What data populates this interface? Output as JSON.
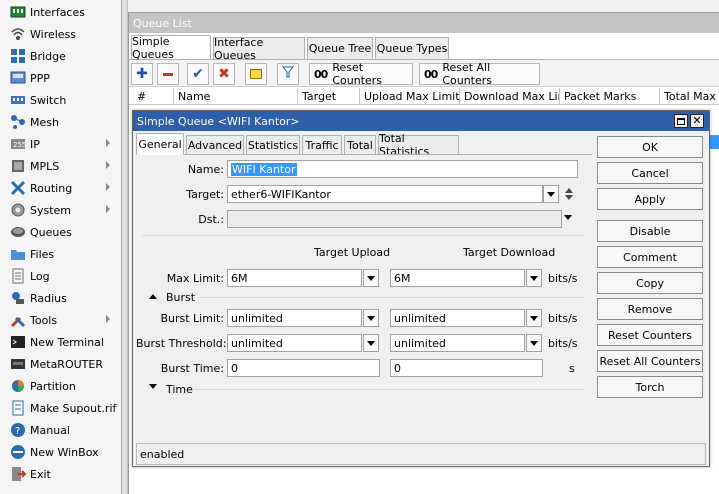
{
  "sidebar": {
    "items": [
      {
        "label": "Interfaces",
        "icon": "interfaces-icon",
        "submenu": false
      },
      {
        "label": "Wireless",
        "icon": "wireless-icon",
        "submenu": false
      },
      {
        "label": "Bridge",
        "icon": "bridge-icon",
        "submenu": false
      },
      {
        "label": "PPP",
        "icon": "ppp-icon",
        "submenu": false
      },
      {
        "label": "Switch",
        "icon": "switch-icon",
        "submenu": false
      },
      {
        "label": "Mesh",
        "icon": "mesh-icon",
        "submenu": false
      },
      {
        "label": "IP",
        "icon": "ip-icon",
        "submenu": true
      },
      {
        "label": "MPLS",
        "icon": "mpls-icon",
        "submenu": true
      },
      {
        "label": "Routing",
        "icon": "routing-icon",
        "submenu": true
      },
      {
        "label": "System",
        "icon": "system-icon",
        "submenu": true
      },
      {
        "label": "Queues",
        "icon": "queues-icon",
        "submenu": false
      },
      {
        "label": "Files",
        "icon": "files-icon",
        "submenu": false
      },
      {
        "label": "Log",
        "icon": "log-icon",
        "submenu": false
      },
      {
        "label": "Radius",
        "icon": "radius-icon",
        "submenu": false
      },
      {
        "label": "Tools",
        "icon": "tools-icon",
        "submenu": true
      },
      {
        "label": "New Terminal",
        "icon": "terminal-icon",
        "submenu": false
      },
      {
        "label": "MetaROUTER",
        "icon": "metarouter-icon",
        "submenu": false
      },
      {
        "label": "Partition",
        "icon": "partition-icon",
        "submenu": false
      },
      {
        "label": "Make Supout.rif",
        "icon": "supout-icon",
        "submenu": false
      },
      {
        "label": "Manual",
        "icon": "manual-icon",
        "submenu": false
      },
      {
        "label": "New WinBox",
        "icon": "winbox-icon",
        "submenu": false
      },
      {
        "label": "Exit",
        "icon": "exit-icon",
        "submenu": false
      }
    ]
  },
  "queue_list": {
    "title": "Queue List",
    "tabs": [
      "Simple Queues",
      "Interface Queues",
      "Queue Tree",
      "Queue Types"
    ],
    "toolbar": {
      "reset_counters": "Reset Counters",
      "reset_all_counters": "Reset All Counters",
      "oo": "00"
    },
    "columns": [
      "#",
      "Name",
      "Target",
      "Upload Max Limit",
      "Download Max Limit",
      "Packet Marks",
      "Total Max Li"
    ]
  },
  "dialog": {
    "title": "Simple Queue <WIFI Kantor>",
    "tabs": [
      "General",
      "Advanced",
      "Statistics",
      "Traffic",
      "Total",
      "Total Statistics"
    ],
    "general": {
      "name_label": "Name:",
      "name_value": "WIFI Kantor",
      "target_label": "Target:",
      "target_value": "ether6-WIFIKantor",
      "dst_label": "Dst.:",
      "dst_value": "",
      "col_upload": "Target Upload",
      "col_download": "Target Download",
      "max_limit_label": "Max Limit:",
      "max_limit_up": "6M",
      "max_limit_down": "6M",
      "units_bits": "bits/s",
      "burst_section": "Burst",
      "burst_limit_label": "Burst Limit:",
      "burst_limit_up": "unlimited",
      "burst_limit_down": "unlimited",
      "burst_threshold_label": "Burst Threshold:",
      "burst_threshold_up": "unlimited",
      "burst_threshold_down": "unlimited",
      "burst_time_label": "Burst Time:",
      "burst_time_up": "0",
      "burst_time_down": "0",
      "units_s": "s",
      "time_section": "Time"
    },
    "buttons": [
      "OK",
      "Cancel",
      "Apply",
      "Disable",
      "Comment",
      "Copy",
      "Remove",
      "Reset Counters",
      "Reset All Counters",
      "Torch"
    ],
    "status": "enabled"
  },
  "colors": {
    "title_active": "#2f5fa8",
    "title_inactive": "#c3c3c3",
    "selection": "#3399ff"
  }
}
